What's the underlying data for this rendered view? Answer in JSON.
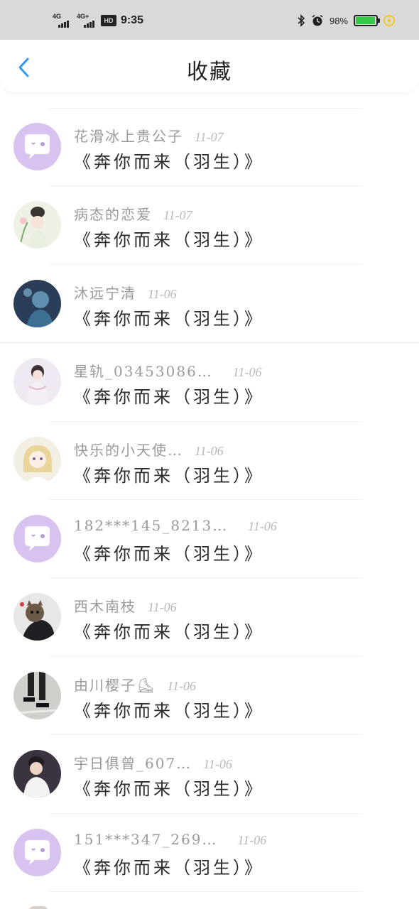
{
  "status_bar": {
    "network1": "4G",
    "network2": "4G+",
    "hd": "HD",
    "time": "9:35",
    "battery_percent": "98%",
    "battery_level": 0.98,
    "bluetooth_icon": "bluetooth-icon",
    "alarm_icon": "alarm-icon",
    "charging_icon": "charging-icon",
    "battery_color": "#35c94a"
  },
  "header": {
    "title": "收藏",
    "back_icon": "chevron-left-icon",
    "accent": "#2f9bf0"
  },
  "items": [
    {
      "name": "花滑冰上贵公子",
      "date": "11-07",
      "title": "《奔你而来（羽生）》",
      "avatar": "default-chat-avatar"
    },
    {
      "name": "病态的恋爱",
      "date": "11-07",
      "title": "《奔你而来（羽生）》",
      "avatar": "illustrated-girl-avatar"
    },
    {
      "name": "沐远宁清",
      "date": "11-06",
      "title": "《奔你而来（羽生）》",
      "avatar": "blue-figure-avatar"
    },
    {
      "name": "星轨_03453086…",
      "date": "11-06",
      "title": "《奔你而来（羽生）》",
      "avatar": "lady-in-white-avatar"
    },
    {
      "name": "快乐的小天使…",
      "date": "11-06",
      "title": "《奔你而来（羽生）》",
      "avatar": "anime-girl-avatar"
    },
    {
      "name": "182***145_8213…",
      "date": "11-06",
      "title": "《奔你而来（羽生）》",
      "avatar": "default-chat-avatar"
    },
    {
      "name": "西木南枝",
      "date": "11-06",
      "title": "《奔你而来（羽生）》",
      "avatar": "cat-with-person-avatar"
    },
    {
      "name": "由川樱子⛸",
      "date": "11-06",
      "title": "《奔你而来（羽生）》",
      "avatar": "skates-on-ice-avatar"
    },
    {
      "name": "宇日俱曾_607…",
      "date": "11-06",
      "title": "《奔你而来（羽生）》",
      "avatar": "man-in-white-avatar"
    },
    {
      "name": "151***347_269…",
      "date": "11-06",
      "title": "《奔你而来（羽生）》",
      "avatar": "default-chat-avatar"
    }
  ],
  "colors": {
    "default_avatar_bg": "#d7c2f0",
    "name_color": "#9a9a9a",
    "date_color": "#b8b8b8"
  }
}
